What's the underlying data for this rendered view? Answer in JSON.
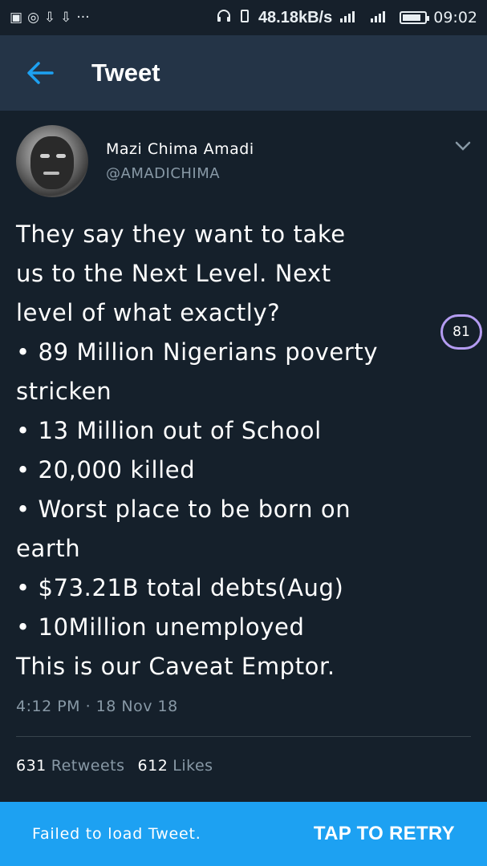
{
  "status_bar": {
    "left_icons": [
      "notification-icon",
      "whatsapp-icon",
      "download-icon",
      "download-icon",
      "more-dots"
    ],
    "left_glyphs": [
      "▣",
      "◎",
      "⇩",
      "⇩",
      "···"
    ],
    "speed": "48.18kB/s",
    "time": "09:02"
  },
  "appbar": {
    "title": "Tweet"
  },
  "tweet": {
    "author_name": "Mazi Chima Amadi",
    "author_handle": "@AMADICHIMA",
    "lines": [
      "They say they want to take",
      "us to the Next Level. Next",
      "level of what exactly?",
      "• 89 Million Nigerians poverty",
      "stricken",
      "• 13 Million out of School",
      "• 20,000 killed",
      "• Worst place to be born on",
      "earth",
      "• $73.21B total debts(Aug)",
      "• 10Million unemployed",
      "This is our Caveat Emptor."
    ],
    "counter_badge": "81",
    "timestamp": "4:12 PM · 18 Nov 18",
    "retweets_count": "631",
    "retweets_label": "Retweets",
    "likes_count": "612",
    "likes_label": "Likes"
  },
  "snackbar": {
    "message": "Failed to load Tweet.",
    "action_label": "TAP TO RETRY"
  },
  "colors": {
    "background": "#15202b",
    "appbar": "#243447",
    "accent": "#1da1f2",
    "secondary_text": "#8899a6",
    "badge_ring": "#b49cf2"
  }
}
